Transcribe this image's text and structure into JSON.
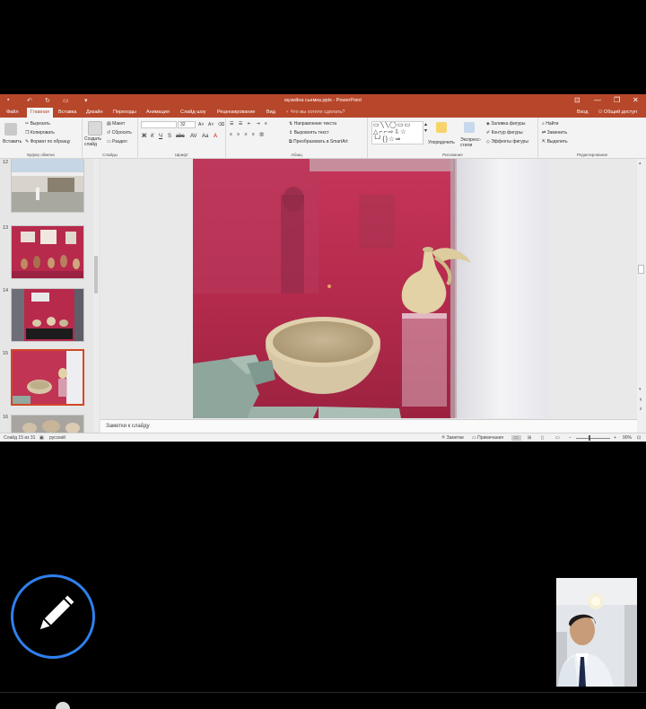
{
  "window": {
    "title": "музейна сьемка.pptx - PowerPoint",
    "controls": [
      "—",
      "❐",
      "✕"
    ]
  },
  "tabs": [
    {
      "label": "Файл",
      "active": false
    },
    {
      "label": "Главная",
      "active": true
    },
    {
      "label": "Вставка",
      "active": false
    },
    {
      "label": "Дизайн",
      "active": false
    },
    {
      "label": "Переходы",
      "active": false
    },
    {
      "label": "Анимация",
      "active": false
    },
    {
      "label": "Слайд-шоу",
      "active": false
    },
    {
      "label": "Рецензирование",
      "active": false
    },
    {
      "label": "Вид",
      "active": false
    }
  ],
  "tell_me": "Что вы хотите сделать?",
  "signin": "Вход",
  "share": "Общий доступ",
  "ribbon": {
    "clipboard": {
      "paste": "Вставить",
      "cut": "Вырезать",
      "copy": "Копировать",
      "format_painter": "Формат по образцу",
      "label": "Буфер обмена"
    },
    "slides": {
      "new_slide": "Создать слайд",
      "layout": "Макет",
      "reset": "Сбросить",
      "section": "Раздел",
      "label": "Слайды"
    },
    "font": {
      "label": "Шрифт",
      "size": "32"
    },
    "paragraph": {
      "label": "Абзац",
      "text_direction": "Направление текста",
      "align_text": "Выровнять текст",
      "smartart": "Преобразовать в SmartArt"
    },
    "drawing": {
      "label": "Рисование",
      "arrange": "Упорядочить",
      "quick_styles": "Экспресс-стили",
      "shape_fill": "Заливка фигуры",
      "shape_outline": "Контур фигуры",
      "shape_effects": "Эффекты фигуры"
    },
    "editing": {
      "label": "Редактирование",
      "find": "Найти",
      "replace": "Заменить",
      "select": "Выделить"
    }
  },
  "slides_pane": [
    {
      "number": "12",
      "selected": false
    },
    {
      "number": "13",
      "selected": false
    },
    {
      "number": "14",
      "selected": false
    },
    {
      "number": "15",
      "selected": true
    },
    {
      "number": "16",
      "selected": false
    }
  ],
  "notes_placeholder": "Заметки к слайду",
  "status": {
    "slide_info": "Слайд 15 из 31",
    "language": "русский",
    "notes": "Заметки",
    "comments": "Примечания",
    "zoom": "90%"
  },
  "icons": {
    "pencil": "pencil-icon"
  },
  "colors": {
    "ppt_accent": "#b7472a",
    "selection": "#d24726",
    "pencil_ring": "#2f80ed"
  }
}
